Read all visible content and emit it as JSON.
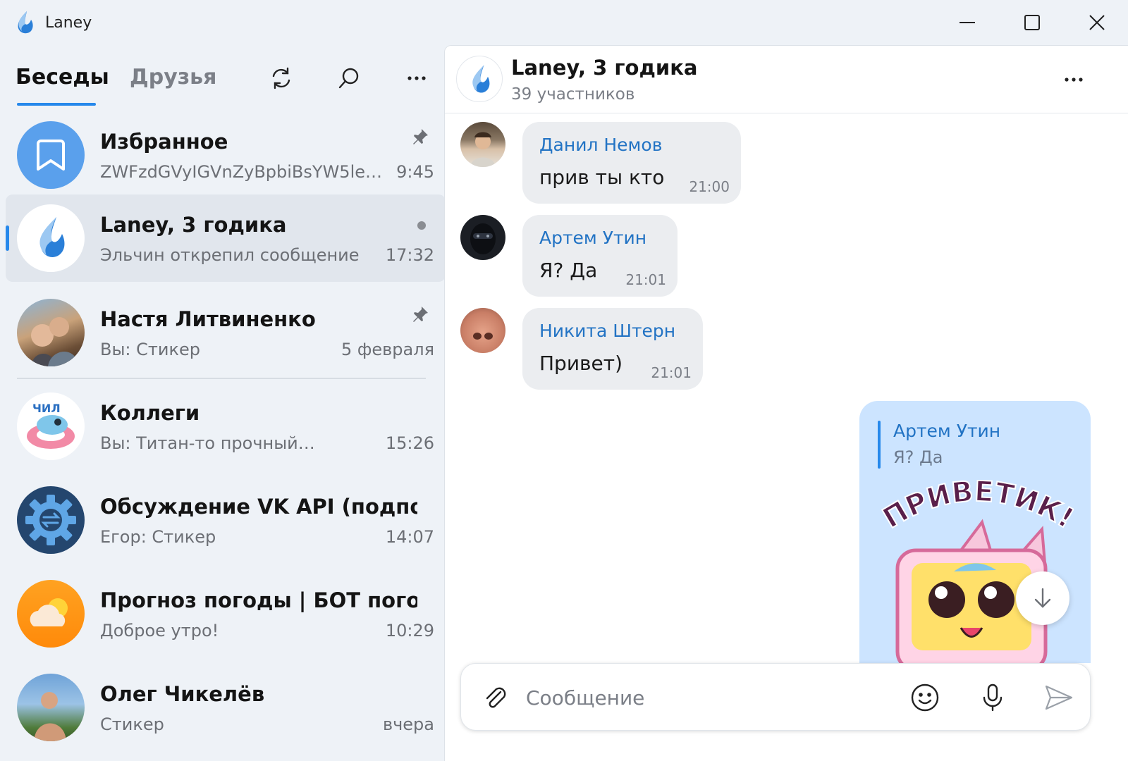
{
  "app": {
    "title": "Laney",
    "accent": "#2688eb"
  },
  "window_controls": {
    "minimize_icon": "minimize-icon",
    "maximize_icon": "maximize-icon",
    "close_icon": "close-icon"
  },
  "tabs": {
    "chats": "Беседы",
    "friends": "Друзья",
    "active": "chats"
  },
  "toolbar": {
    "refresh_icon": "refresh-icon",
    "search_icon": "search-icon",
    "more_icon": "more-icon"
  },
  "chats": [
    {
      "name": "Избранное",
      "preview": "ZWFzdGVyIGVnZyBpbiBsYW5leSB…",
      "time": "9:45",
      "pinned": true,
      "avatar": "bookmark-icon"
    },
    {
      "name": "Laney, 3 годика",
      "preview": "Эльчин открепил сообщение",
      "time": "17:32",
      "active": true,
      "unread_dot": true,
      "avatar": "laney-logo"
    },
    {
      "name": "Настя Литвиненко",
      "preview": "Вы: Стикер",
      "time": "5 февраля",
      "pinned": true,
      "avatar": "photo"
    },
    {
      "name": "Коллеги",
      "preview": "Вы: Титан-то прочный…",
      "time": "15:26",
      "avatar": "sticker-avatar"
    },
    {
      "name": "Обсуждение VK API (подполье",
      "preview": "Егор: Стикер",
      "time": "14:07",
      "avatar": "gear-api-icon"
    },
    {
      "name": "Прогноз погоды | БОТ погода",
      "preview": "Доброе утро!",
      "time": "10:29",
      "avatar": "weather-icon"
    },
    {
      "name": "Олег Чикелёв",
      "preview": "Стикер",
      "time": "вчера",
      "avatar": "photo"
    }
  ],
  "conversation": {
    "title": "Laney, 3 годика",
    "subtitle": "39 участников",
    "messages": [
      {
        "author": "Данил Немов",
        "text": "прив ты кто",
        "time": "21:00"
      },
      {
        "author": "Артем Утин",
        "text": "Я? Да",
        "time": "21:01"
      },
      {
        "author": "Никита Штерн",
        "text": "Привет)",
        "time": "21:01"
      }
    ],
    "outgoing": {
      "reply_author": "Артем Утин",
      "reply_text": "Я? Да",
      "sticker_text": "ПРИВЕТИК!"
    }
  },
  "composer": {
    "placeholder": "Сообщение",
    "value": ""
  }
}
